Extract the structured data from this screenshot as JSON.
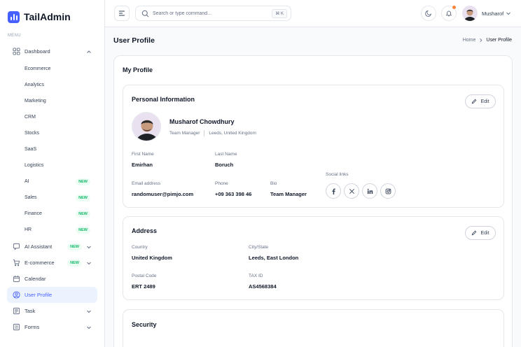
{
  "brand": {
    "name": "TailAdmin"
  },
  "sidebar": {
    "menu_label": "MENU",
    "dashboard": {
      "label": "Dashboard",
      "subitems": [
        {
          "label": "Ecommerce",
          "badge": ""
        },
        {
          "label": "Analytics",
          "badge": ""
        },
        {
          "label": "Marketing",
          "badge": ""
        },
        {
          "label": "CRM",
          "badge": ""
        },
        {
          "label": "Stocks",
          "badge": ""
        },
        {
          "label": "SaaS",
          "badge": ""
        },
        {
          "label": "Logistics",
          "badge": ""
        },
        {
          "label": "AI",
          "badge": "NEW"
        },
        {
          "label": "Sales",
          "badge": "NEW"
        },
        {
          "label": "Finance",
          "badge": "NEW"
        },
        {
          "label": "HR",
          "badge": "NEW"
        }
      ]
    },
    "items": [
      {
        "label": "AI Assistant",
        "badge": "NEW"
      },
      {
        "label": "E-commerce",
        "badge": "NEW"
      },
      {
        "label": "Calendar"
      },
      {
        "label": "User Profile"
      },
      {
        "label": "Task"
      },
      {
        "label": "Forms"
      }
    ]
  },
  "header": {
    "search_placeholder": "Search or type command...",
    "search_shortcut": "⌘ K",
    "user_name": "Musharof"
  },
  "page": {
    "title": "User Profile",
    "breadcrumb": {
      "home": "Home",
      "current": "User Profile"
    },
    "card_title": "My Profile"
  },
  "personal": {
    "title": "Personal Information",
    "edit_label": "Edit",
    "name": "Musharof Chowdhury",
    "role": "Team Manager",
    "location": "Leeds, United Kingdom",
    "first_name": {
      "label": "First Name",
      "value": "Emirhan"
    },
    "last_name": {
      "label": "Last Name",
      "value": "Boruch"
    },
    "email": {
      "label": "Email address",
      "value": "randomuser@pimjo.com"
    },
    "phone": {
      "label": "Phone",
      "value": "+09 363 398 46"
    },
    "bio": {
      "label": "Bio",
      "value": "Team Manager"
    },
    "social_label": "Social links"
  },
  "address": {
    "title": "Address",
    "edit_label": "Edit",
    "country": {
      "label": "Country",
      "value": "United Kingdom"
    },
    "city": {
      "label": "City/State",
      "value": "Leeds, East London"
    },
    "postal": {
      "label": "Postal Code",
      "value": "ERT 2489"
    },
    "tax": {
      "label": "TAX ID",
      "value": "AS4568384"
    }
  },
  "security": {
    "title": "Security"
  },
  "colors": {
    "accent": "#465fff",
    "badge_green": "#12b76a",
    "notify": "#fd853a",
    "border": "#e4e7ec"
  }
}
